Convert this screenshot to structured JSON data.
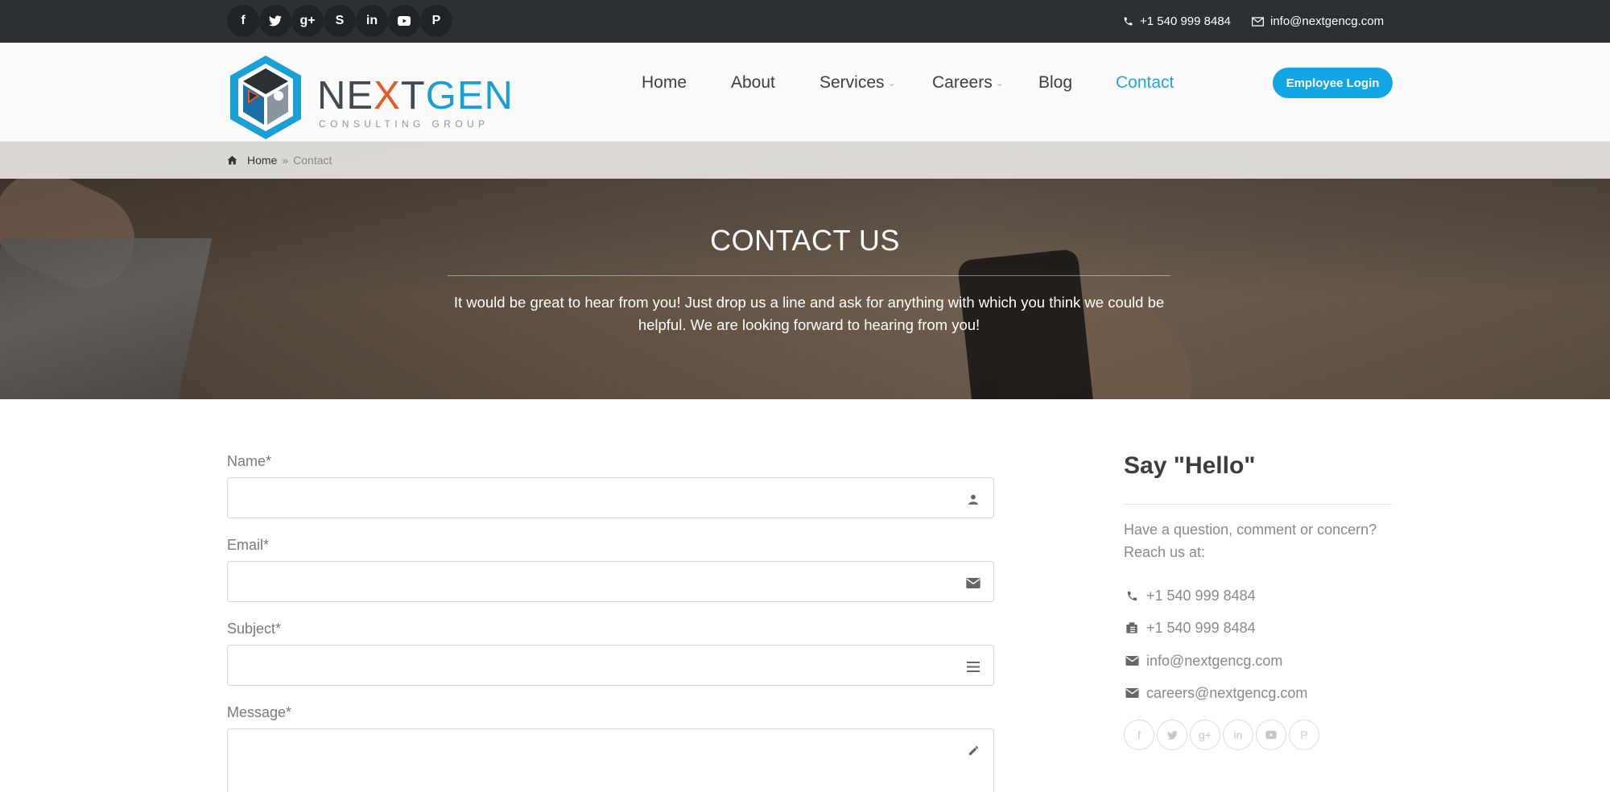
{
  "topbar": {
    "social": [
      "f",
      "𝕥",
      "g+",
      "S",
      "in",
      "▶",
      "P"
    ],
    "social_names": [
      "facebook-icon",
      "twitter-icon",
      "google-plus-icon",
      "skype-icon",
      "linkedin-icon",
      "youtube-icon",
      "pinterest-icon"
    ],
    "phone": "+1 540 999 8484",
    "email": "info@nextgencg.com"
  },
  "header": {
    "logo_ne": "NE",
    "logo_x": "X",
    "logo_t": "T",
    "logo_gen": "GEN",
    "logo_sub": "CONSULTING GROUP",
    "nav": {
      "home": "Home",
      "about": "About",
      "services": "Services",
      "careers": "Careers",
      "blog": "Blog",
      "contact": "Contact"
    },
    "login": "Employee Login"
  },
  "breadcrumb": {
    "home": "Home",
    "separator": "»",
    "current": "Contact"
  },
  "hero": {
    "title": "CONTACT US",
    "line1": "It would be great to hear from you! Just drop us a line and ask for anything with which you think we could be",
    "line2": "helpful. We are looking forward to hearing from you!"
  },
  "form": {
    "name_label": "Name*",
    "email_label": "Email*",
    "subject_label": "Subject*",
    "message_label": "Message*"
  },
  "sidebar": {
    "title": "Say \"Hello\"",
    "text_line1": "Have a question, comment or concern?",
    "text_line2": "Reach us at:",
    "phone": "+1 540 999 8484",
    "fax": "+1 540 999 8484",
    "email_info": "info@nextgencg.com",
    "email_careers": "careers@nextgencg.com"
  },
  "colors": {
    "topbar": "#2b3035",
    "accent": "#12a7e4",
    "logo_orange": "#e45a25",
    "logo_blue": "#1a9fd6"
  }
}
